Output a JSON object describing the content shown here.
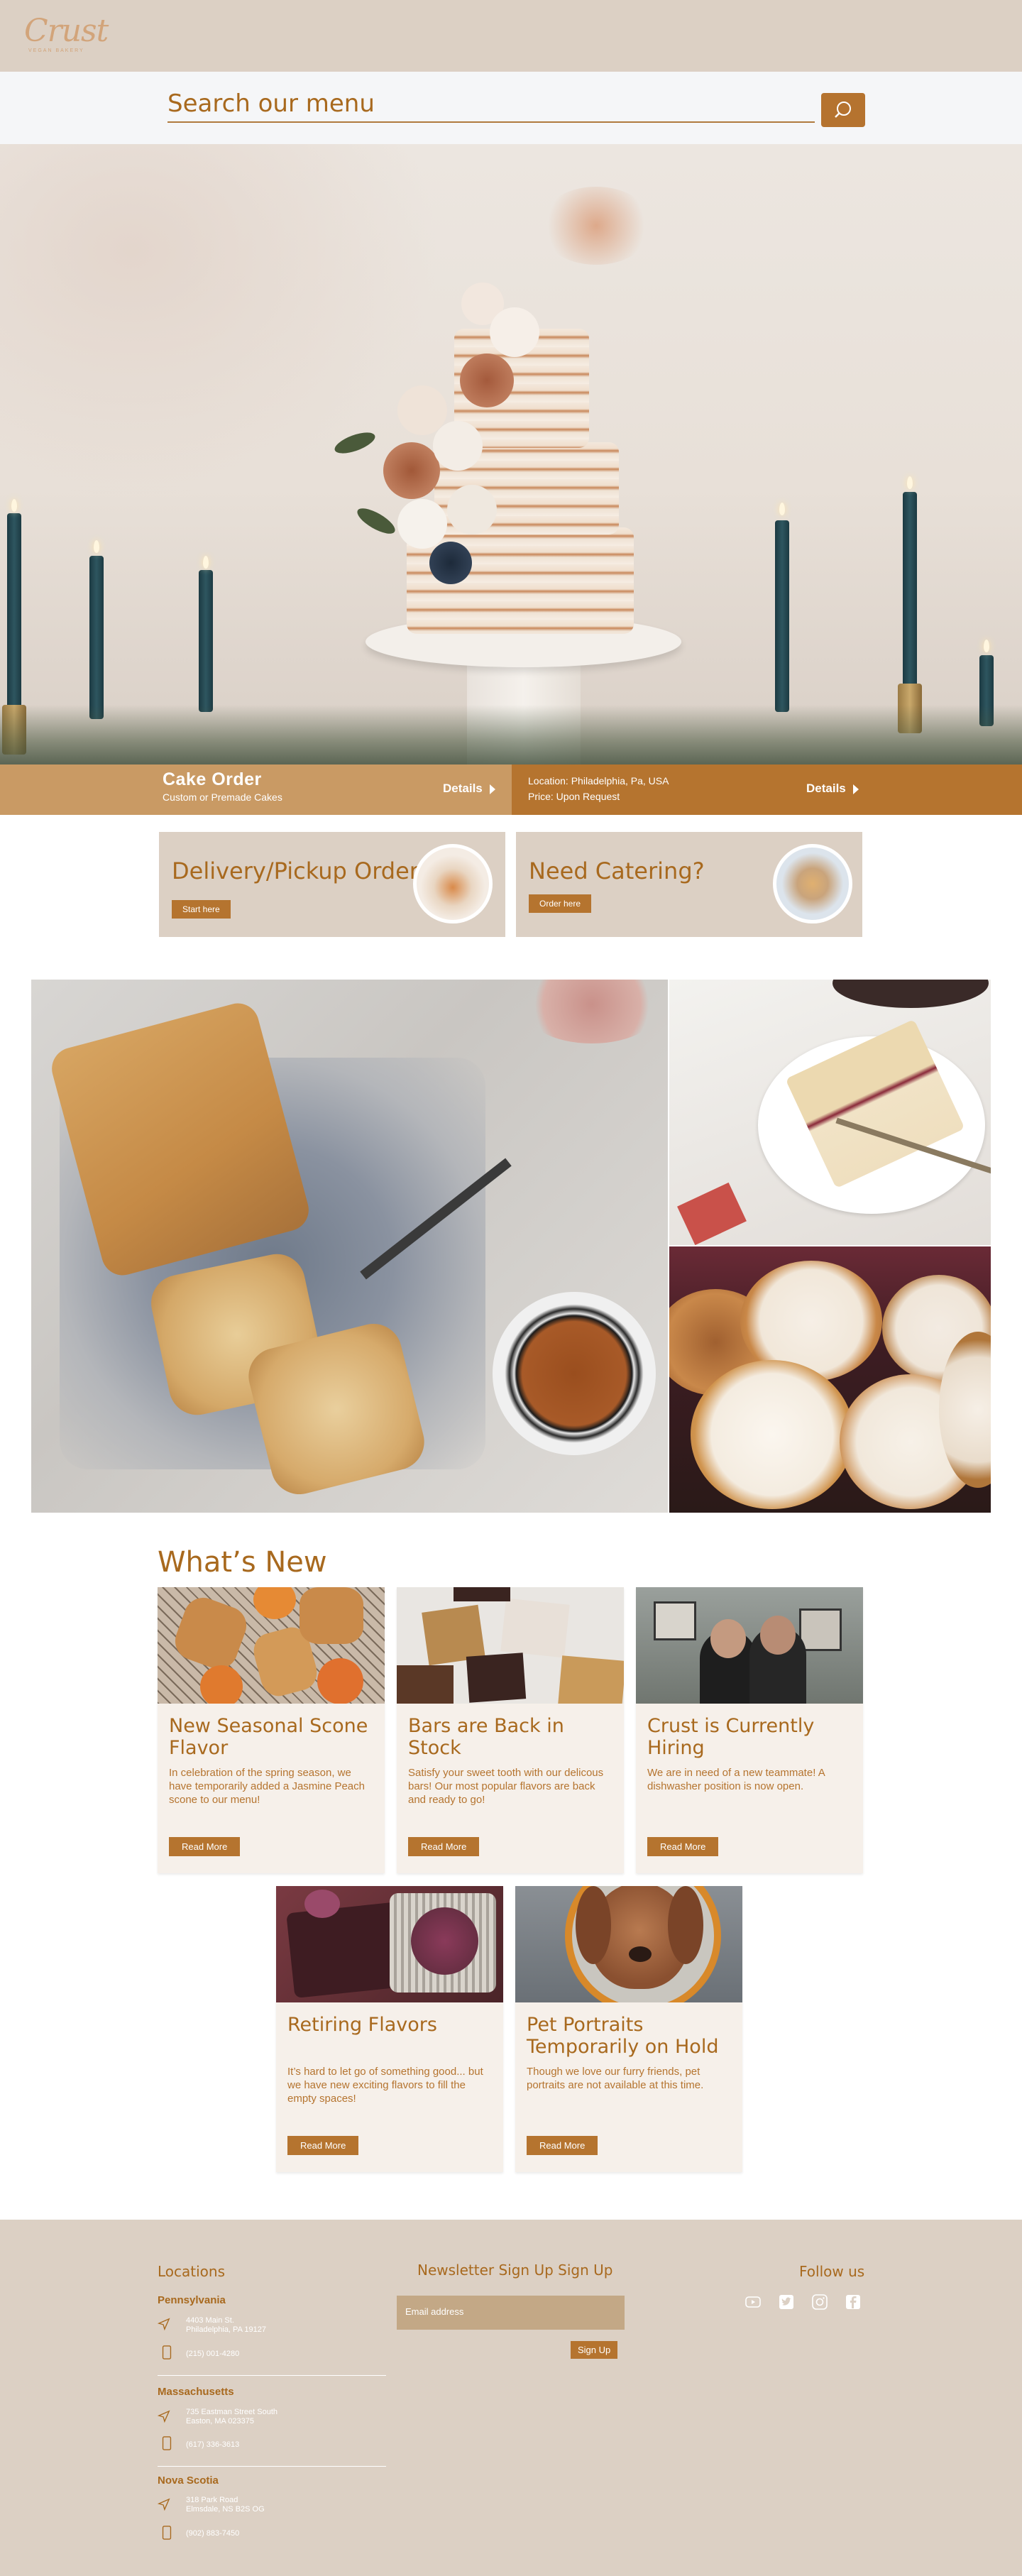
{
  "brand": {
    "logo_text": "Crust",
    "logo_sub": "VEGAN BAKERY"
  },
  "search": {
    "placeholder": "Search our menu"
  },
  "info_bar": {
    "title": "Cake Order",
    "subtitle": "Custom or Premade Cakes",
    "details_left": "Details",
    "location": "Location: Philadelphia, Pa, USA",
    "price": "Price: Upon Request",
    "details_right": "Details"
  },
  "promos": [
    {
      "title": "Delivery/Pickup Orders",
      "button": "Start here"
    },
    {
      "title": "Need Catering?",
      "button": "Order here"
    }
  ],
  "whats_new": {
    "heading": "What’s New",
    "cards": [
      {
        "title": "New Seasonal Scone Flavor",
        "body": "In celebration of the spring season, we have temporarily added a Jasmine Peach scone to our menu!",
        "button": "Read More"
      },
      {
        "title": "Bars are Back in Stock",
        "body": "Satisfy your sweet tooth with our delicous bars! Our most popular flavors are back and ready to go!",
        "button": "Read More"
      },
      {
        "title": "Crust is Currently Hiring",
        "body": "We are in need of a new teammate! A dishwasher position is now open.",
        "button": "Read More"
      },
      {
        "title": "Retiring Flavors",
        "body": "It’s hard to let go of something good... but we have new exciting flavors to fill the empty spaces!",
        "button": "Read More"
      },
      {
        "title": "Pet Portraits Temporarily on Hold",
        "body": "Though we love our furry friends, pet portraits are not available at this time.",
        "button": "Read More"
      }
    ]
  },
  "footer": {
    "locations_heading": "Locations",
    "locations": [
      {
        "state": "Pennsylvania",
        "address_line1": "4403 Main St.",
        "address_line2": "Philadelphia, PA 19127",
        "phone": "(215) 001-4280"
      },
      {
        "state": "Massachusetts",
        "address_line1": "735 Eastman Street South",
        "address_line2": "Easton, MA 023375",
        "phone": "(617) 336-3613"
      },
      {
        "state": "Nova Scotia",
        "address_line1": "318 Park Road",
        "address_line2": "Elmsdale, NS B2S OG",
        "phone": "(902) 883-7450"
      }
    ],
    "newsletter_heading": "Newsletter Sign Up Sign Up",
    "email_placeholder": "Email address",
    "signup_button": "Sign Up",
    "follow_heading": "Follow us",
    "social_icons": [
      "youtube-icon",
      "twitter-icon",
      "instagram-icon",
      "facebook-icon"
    ]
  },
  "colors": {
    "accent": "#b5742f",
    "accent_light": "#c99a64",
    "beige": "#dcd0c4",
    "card_bg": "#f6f0ea",
    "text_brown": "#a8691e"
  }
}
